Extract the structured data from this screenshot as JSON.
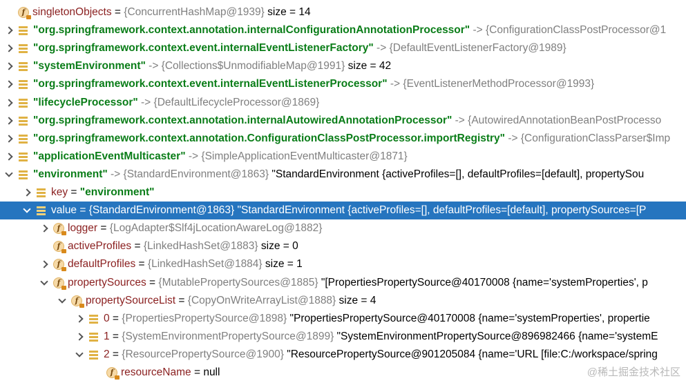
{
  "rows": [
    {
      "icon": "field",
      "arrow": "none",
      "parts": [
        {
          "c": "k",
          "t": "singletonObjects"
        },
        {
          "c": "eq",
          "t": " = "
        },
        {
          "c": "ref",
          "t": "{ConcurrentHashMap@1939}"
        },
        {
          "c": "eq",
          "t": "  size = 14"
        }
      ]
    },
    {
      "icon": "list",
      "arrow": "right",
      "parts": [
        {
          "c": "str",
          "t": "\"org.springframework.context.annotation.internalConfigurationAnnotationProcessor\""
        },
        {
          "c": "ref",
          "t": " -> {ConfigurationClassPostProcessor@1"
        }
      ]
    },
    {
      "icon": "list",
      "arrow": "right",
      "parts": [
        {
          "c": "str",
          "t": "\"org.springframework.context.event.internalEventListenerFactory\""
        },
        {
          "c": "ref",
          "t": " -> {DefaultEventListenerFactory@1989}"
        }
      ]
    },
    {
      "icon": "list",
      "arrow": "right",
      "parts": [
        {
          "c": "str",
          "t": "\"systemEnvironment\""
        },
        {
          "c": "ref",
          "t": " -> {Collections$UnmodifiableMap@1991}"
        },
        {
          "c": "eq",
          "t": "  size = 42"
        }
      ]
    },
    {
      "icon": "list",
      "arrow": "right",
      "parts": [
        {
          "c": "str",
          "t": "\"org.springframework.context.event.internalEventListenerProcessor\""
        },
        {
          "c": "ref",
          "t": " -> {EventListenerMethodProcessor@1993}"
        }
      ]
    },
    {
      "icon": "list",
      "arrow": "right",
      "parts": [
        {
          "c": "str",
          "t": "\"lifecycleProcessor\""
        },
        {
          "c": "ref",
          "t": " -> {DefaultLifecycleProcessor@1869}"
        }
      ]
    },
    {
      "icon": "list",
      "arrow": "right",
      "parts": [
        {
          "c": "str",
          "t": "\"org.springframework.context.annotation.internalAutowiredAnnotationProcessor\""
        },
        {
          "c": "ref",
          "t": " -> {AutowiredAnnotationBeanPostProcesso"
        }
      ]
    },
    {
      "icon": "list",
      "arrow": "right",
      "parts": [
        {
          "c": "str",
          "t": "\"org.springframework.context.annotation.ConfigurationClassPostProcessor.importRegistry\""
        },
        {
          "c": "ref",
          "t": " -> {ConfigurationClassParser$Imp"
        }
      ]
    },
    {
      "icon": "list",
      "arrow": "right",
      "parts": [
        {
          "c": "str",
          "t": "\"applicationEventMulticaster\""
        },
        {
          "c": "ref",
          "t": " -> {SimpleApplicationEventMulticaster@1871}"
        }
      ]
    },
    {
      "icon": "list",
      "arrow": "down",
      "parts": [
        {
          "c": "str",
          "t": "\"environment\""
        },
        {
          "c": "ref",
          "t": " -> {StandardEnvironment@1863}"
        },
        {
          "c": "eq",
          "t": " \"StandardEnvironment {activeProfiles=[], defaultProfiles=[default], propertySou"
        }
      ]
    },
    {
      "icon": "list",
      "arrow": "right",
      "parts": [
        {
          "c": "k",
          "t": "key"
        },
        {
          "c": "eq",
          "t": " = "
        },
        {
          "c": "str",
          "t": "\"environment\""
        }
      ]
    },
    {
      "icon": "list",
      "arrow": "down",
      "sel": true,
      "parts": [
        {
          "c": "k",
          "t": "value"
        },
        {
          "c": "eq",
          "t": " = "
        },
        {
          "c": "ref",
          "t": "{StandardEnvironment@1863}"
        },
        {
          "c": "eq",
          "t": " \"StandardEnvironment {activeProfiles=[], defaultProfiles=[default], propertySources=[P"
        }
      ]
    },
    {
      "icon": "field",
      "arrow": "right",
      "parts": [
        {
          "c": "k",
          "t": "logger"
        },
        {
          "c": "eq",
          "t": " = "
        },
        {
          "c": "ref",
          "t": "{LogAdapter$Slf4jLocationAwareLog@1882}"
        }
      ]
    },
    {
      "icon": "field",
      "arrow": "none",
      "parts": [
        {
          "c": "k",
          "t": "activeProfiles"
        },
        {
          "c": "eq",
          "t": " = "
        },
        {
          "c": "ref",
          "t": "{LinkedHashSet@1883}"
        },
        {
          "c": "eq",
          "t": "  size = 0"
        }
      ]
    },
    {
      "icon": "field",
      "arrow": "right",
      "parts": [
        {
          "c": "k",
          "t": "defaultProfiles"
        },
        {
          "c": "eq",
          "t": " = "
        },
        {
          "c": "ref",
          "t": "{LinkedHashSet@1884}"
        },
        {
          "c": "eq",
          "t": "  size = 1"
        }
      ]
    },
    {
      "icon": "field",
      "arrow": "down",
      "parts": [
        {
          "c": "k",
          "t": "propertySources"
        },
        {
          "c": "eq",
          "t": " = "
        },
        {
          "c": "ref",
          "t": "{MutablePropertySources@1885}"
        },
        {
          "c": "eq",
          "t": " \"[PropertiesPropertySource@40170008 {name='systemProperties', p"
        }
      ]
    },
    {
      "icon": "field",
      "arrow": "down",
      "parts": [
        {
          "c": "k",
          "t": "propertySourceList"
        },
        {
          "c": "eq",
          "t": " = "
        },
        {
          "c": "ref",
          "t": "{CopyOnWriteArrayList@1888}"
        },
        {
          "c": "eq",
          "t": "  size = 4"
        }
      ]
    },
    {
      "icon": "list",
      "arrow": "right",
      "parts": [
        {
          "c": "k",
          "t": "0"
        },
        {
          "c": "eq",
          "t": " = "
        },
        {
          "c": "ref",
          "t": "{PropertiesPropertySource@1898}"
        },
        {
          "c": "eq",
          "t": " \"PropertiesPropertySource@40170008 {name='systemProperties', propertie"
        }
      ]
    },
    {
      "icon": "list",
      "arrow": "right",
      "parts": [
        {
          "c": "k",
          "t": "1"
        },
        {
          "c": "eq",
          "t": " = "
        },
        {
          "c": "ref",
          "t": "{SystemEnvironmentPropertySource@1899}"
        },
        {
          "c": "eq",
          "t": " \"SystemEnvironmentPropertySource@896982466 {name='systemE"
        }
      ]
    },
    {
      "icon": "list",
      "arrow": "down",
      "parts": [
        {
          "c": "k",
          "t": "2"
        },
        {
          "c": "eq",
          "t": " = "
        },
        {
          "c": "ref",
          "t": "{ResourcePropertySource@1900}"
        },
        {
          "c": "eq",
          "t": " \"ResourcePropertySource@901205084 {name='URL [file:C:/workspace/spring"
        }
      ]
    },
    {
      "icon": "field",
      "arrow": "none",
      "parts": [
        {
          "c": "k",
          "t": "resourceName"
        },
        {
          "c": "eq",
          "t": " = null"
        }
      ]
    }
  ],
  "watermark": "@稀土掘金技术社区"
}
